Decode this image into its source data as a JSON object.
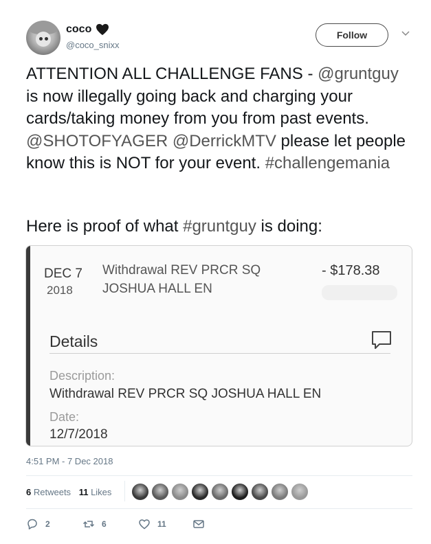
{
  "user": {
    "display_name": "coco",
    "handle": "@coco_snixx",
    "follow_label": "Follow"
  },
  "tweet": {
    "segments": [
      {
        "text": "ATTENTION ALL CHALLENGE FANS - ",
        "link": false
      },
      {
        "text": "@gruntguy",
        "link": true
      },
      {
        "text": " is now illegally going back and charging your cards/taking money from you from past events. ",
        "link": false
      },
      {
        "text": "@SHOTOFYAGER",
        "link": true
      },
      {
        "text": " ",
        "link": false
      },
      {
        "text": "@DerrickMTV",
        "link": true
      },
      {
        "text": " please let people know this is NOT for your event. ",
        "link": false
      },
      {
        "text": "#challengemania",
        "link": true
      }
    ],
    "proof_prefix": "Here is proof of what ",
    "proof_tag": "#gruntguy",
    "proof_suffix": " is doing:"
  },
  "media": {
    "month_day": "DEC 7",
    "year": "2018",
    "desc_line1": "Withdrawal REV PRCR SQ",
    "desc_line2": "JOSHUA HALL EN",
    "amount": "- $178.38",
    "details_title": "Details",
    "description_label": "Description:",
    "description_value": "Withdrawal REV PRCR SQ JOSHUA HALL EN",
    "date_label": "Date:",
    "date_value": "12/7/2018"
  },
  "meta": {
    "timestamp": "4:51 PM - 7 Dec 2018",
    "retweets_count": "6",
    "retweets_label": "Retweets",
    "likes_count": "11",
    "likes_label": "Likes"
  },
  "actions": {
    "reply_count": "2",
    "retweet_count": "6",
    "like_count": "11"
  },
  "liker_shades": [
    "#3a3a3a",
    "#5a5a5a",
    "#8a8a8a",
    "#2a2a2a",
    "#6a6a6a",
    "#1e1e1e",
    "#4a4a4a",
    "#7a7a7a",
    "#999999"
  ]
}
